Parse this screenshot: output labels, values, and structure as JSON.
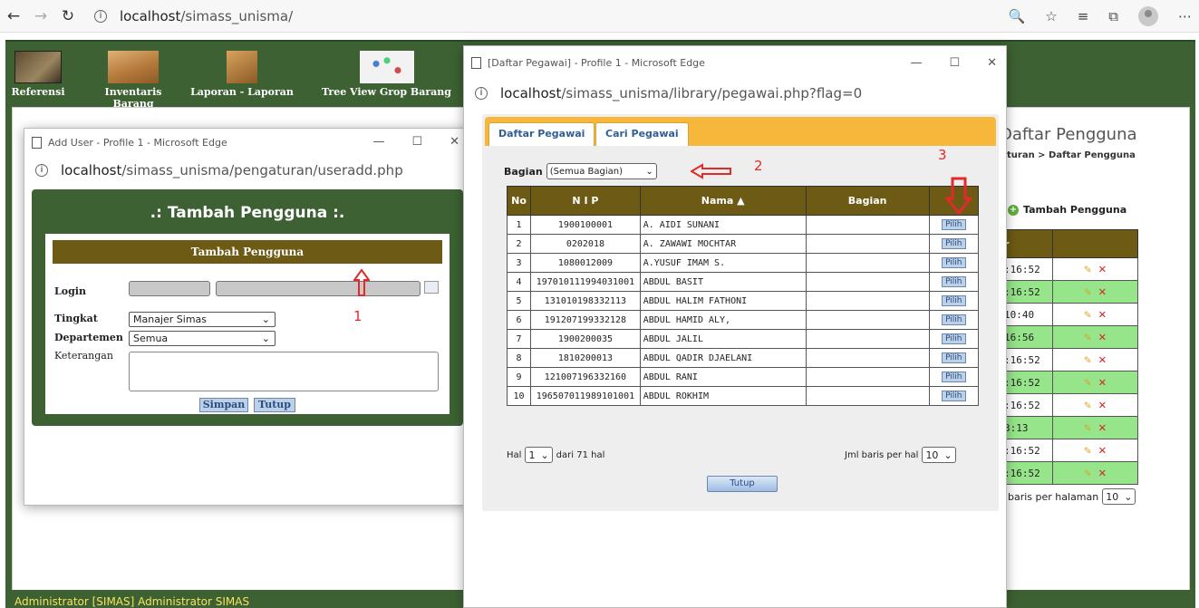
{
  "browser": {
    "url_host": "localhost",
    "url_path": "/simass_unisma/"
  },
  "menu": [
    {
      "label": "Referensi"
    },
    {
      "label": "Inventaris Barang"
    },
    {
      "label": "Laporan - Laporan"
    },
    {
      "label": "Tree View Grop Barang"
    }
  ],
  "main": {
    "page_title": "Daftar Pengguna",
    "breadcrumb": "turan > Daftar Pengguna",
    "add_link": "Tambah Pengguna",
    "col_header": "r",
    "rows": [
      ":16:52",
      ":16:52",
      "10:40",
      "16:56",
      ":16:52",
      ":16:52",
      ":16:52",
      "3:13",
      ":16:52",
      ":16:52"
    ],
    "per_page_label": "baris per halaman",
    "per_page_value": "10"
  },
  "footer": "Administrator [SIMAS] Administrator SIMAS",
  "add_user_window": {
    "title": "Add User - Profile 1 - Microsoft Edge",
    "url_host": "localhost",
    "url_path": "/simass_unisma/pengaturan/useradd.php",
    "heading": ".: Tambah Pengguna :.",
    "form_bar": "Tambah Pengguna",
    "login_label": "Login",
    "tingkat_label": "Tingkat",
    "tingkat_value": "Manajer Simas",
    "departemen_label": "Departemen",
    "departemen_value": "Semua",
    "keterangan_label": "Keterangan",
    "save_label": "Simpan",
    "close_label": "Tutup",
    "annotation": "1"
  },
  "pegawai_window": {
    "title": "[Daftar Pegawai] - Profile 1 - Microsoft Edge",
    "url_host": "localhost",
    "url_path": "/simass_unisma/library/pegawai.php?flag=0",
    "tabs": [
      "Daftar Pegawai",
      "Cari Pegawai"
    ],
    "bagian_label": "Bagian",
    "bagian_value": "(Semua Bagian)",
    "columns": [
      "No",
      "N I P",
      "Nama ▲",
      "Bagian",
      ""
    ],
    "rows": [
      {
        "no": "1",
        "nip": "1900100001",
        "nama": "A. AIDI SUNANI",
        "bagian": "",
        "action": "Pilih"
      },
      {
        "no": "2",
        "nip": "0202018",
        "nama": "A. ZAWAWI MOCHTAR",
        "bagian": "",
        "action": "Pilih"
      },
      {
        "no": "3",
        "nip": "1080012009",
        "nama": "A.YUSUF IMAM S.",
        "bagian": "",
        "action": "Pilih"
      },
      {
        "no": "4",
        "nip": "197010111994031001",
        "nama": "ABDUL BASIT",
        "bagian": "",
        "action": "Pilih"
      },
      {
        "no": "5",
        "nip": "131010198332113",
        "nama": "ABDUL HALIM FATHONI",
        "bagian": "",
        "action": "Pilih"
      },
      {
        "no": "6",
        "nip": "191207199332128",
        "nama": "ABDUL HAMID ALY,",
        "bagian": "",
        "action": "Pilih"
      },
      {
        "no": "7",
        "nip": "1900200035",
        "nama": "ABDUL JALIL",
        "bagian": "",
        "action": "Pilih"
      },
      {
        "no": "8",
        "nip": "1810200013",
        "nama": "ABDUL QADIR DJAELANI",
        "bagian": "",
        "action": "Pilih"
      },
      {
        "no": "9",
        "nip": "121007196332160",
        "nama": "ABDUL RANI",
        "bagian": "",
        "action": "Pilih"
      },
      {
        "no": "10",
        "nip": "196507011989101001",
        "nama": "ABDUL ROKHIM",
        "bagian": "",
        "action": "Pilih"
      }
    ],
    "hal_label": "Hal",
    "hal_value": "1",
    "hal_total": "dari 71 hal",
    "jml_label": "Jml baris per hal",
    "jml_value": "10",
    "close_label": "Tutup",
    "annotation_2": "2",
    "annotation_3": "3"
  }
}
